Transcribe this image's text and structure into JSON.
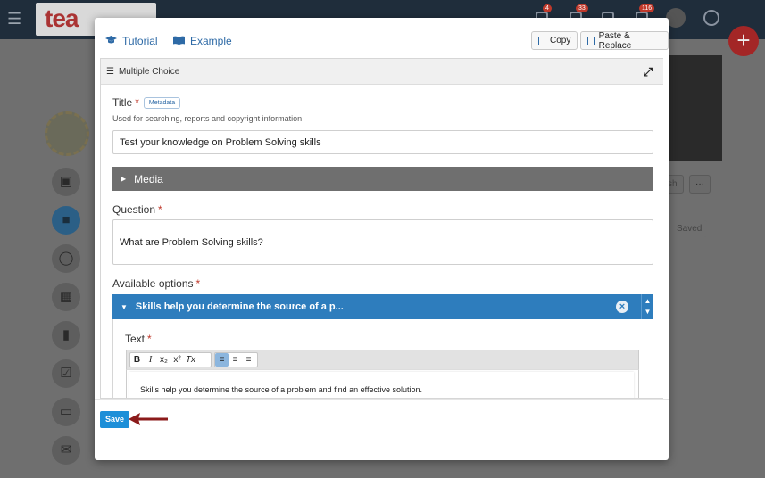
{
  "header": {
    "tutorial_label": "Tutorial",
    "example_label": "Example",
    "copy_label": "Copy",
    "paste_replace_label": "Paste & Replace"
  },
  "section": {
    "title": "Multiple Choice"
  },
  "title_field": {
    "label": "Title",
    "required_mark": "*",
    "metadata_tag": "Metadata",
    "helper": "Used for searching, reports and copyright information",
    "value": "Test your knowledge on Problem Solving skills"
  },
  "media": {
    "label": "Media"
  },
  "question_field": {
    "label": "Question",
    "required_mark": "*",
    "value": "What are Problem Solving skills?"
  },
  "options": {
    "label": "Available options",
    "required_mark": "*",
    "items": [
      {
        "summary": "Skills help you determine the source of a p...",
        "text_label": "Text",
        "required_mark": "*",
        "text_value": "Skills help you determine the source of a problem and find an effective solution."
      }
    ]
  },
  "toolbar": {
    "buttons": [
      "B",
      "I",
      "x₂",
      "x²",
      "Tx"
    ]
  },
  "footer": {
    "save_label": "Save"
  },
  "background": {
    "logo_text": "tea",
    "badges": [
      "4",
      "33",
      "116"
    ],
    "publish_fragment": "sh",
    "saved_label": "Saved"
  },
  "colors": {
    "accent": "#2e7dbd",
    "save": "#1d8fd8",
    "required": "#c0392b",
    "arrow": "#8b1a1a"
  }
}
